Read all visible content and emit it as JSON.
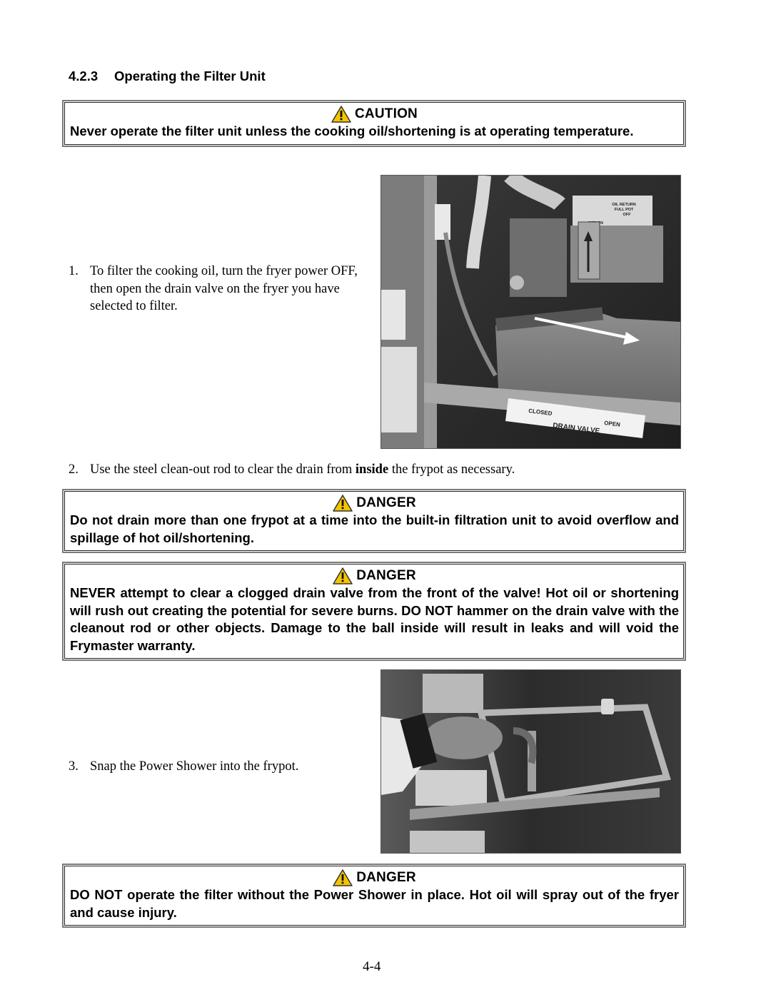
{
  "section": {
    "number": "4.2.3",
    "title": "Operating the Filter Unit"
  },
  "caution_box": {
    "icon": "warning-triangle-icon",
    "label": "CAUTION",
    "text": "Never operate the filter unit unless the cooking oil/shortening is at operating temperature."
  },
  "steps": [
    {
      "number": "1.",
      "text": "To filter the cooking oil, turn the fryer power OFF, then open the drain valve on the fryer you have selected to filter."
    },
    {
      "number": "2.",
      "text_before": "Use the steel clean-out rod to clear the drain from ",
      "text_bold": "inside",
      "text_after": " the frypot as necessary."
    },
    {
      "number": "3.",
      "text": "Snap the Power Shower into the frypot."
    }
  ],
  "photo1": {
    "description": "Drain valve inside fryer cabinet with arrow pointing to valve handle",
    "label_oil_return": [
      "OIL RETURN",
      "FULL POT",
      "OFF"
    ],
    "label_return": "RETURN",
    "label_closed": "CLOSED",
    "label_open": "OPEN",
    "label_drain_valve": "DRAIN VALVE"
  },
  "photo2": {
    "description": "Hand snapping the Power Shower into the frypot"
  },
  "danger_boxes": [
    {
      "label": "DANGER",
      "text": "Do not drain more than one frypot at a time into the built-in filtration unit to avoid overflow and spillage of hot oil/shortening."
    },
    {
      "label": "DANGER",
      "text": "NEVER attempt to clear a clogged drain valve from the front of the valve!  Hot oil or shortening will rush out creating the potential for severe burns.  DO NOT hammer on the drain valve with the cleanout rod or other objects.  Damage to the ball inside will result in leaks and will void the Frymaster warranty."
    },
    {
      "label": "DANGER",
      "text": "DO NOT operate the filter without the Power Shower in place.  Hot oil will spray out of the fryer and cause injury."
    }
  ],
  "colors": {
    "warning_yellow": "#f5c400",
    "border_gray": "#7a7a7a"
  },
  "page_number": "4-4"
}
